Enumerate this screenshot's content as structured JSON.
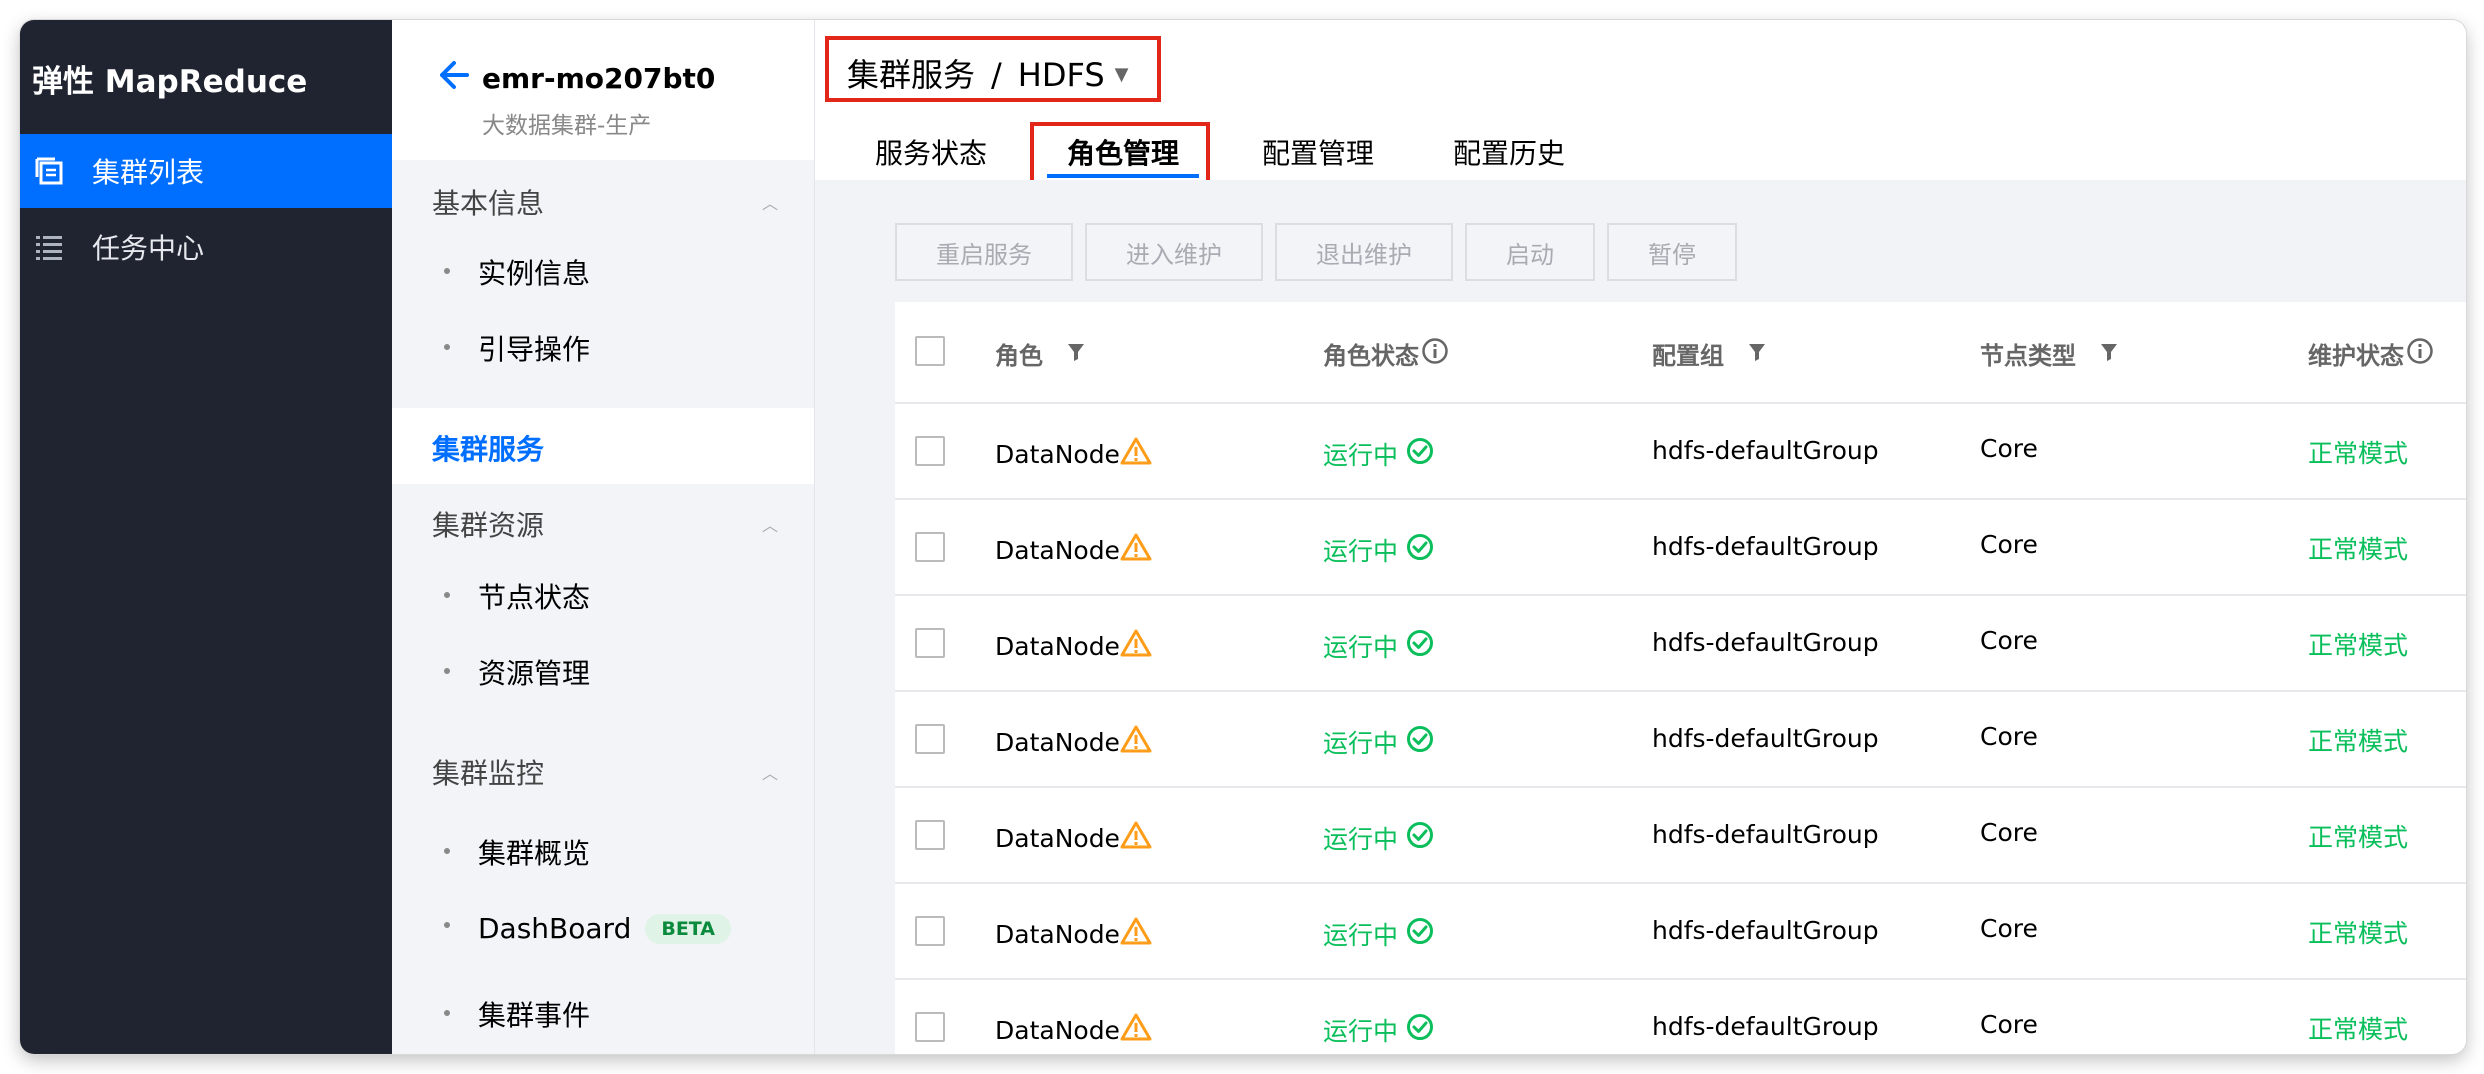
{
  "app": {
    "brand": "弹性 MapReduce"
  },
  "nav": [
    {
      "label": "集群列表",
      "active": true,
      "icon": "cluster-list-icon"
    },
    {
      "label": "任务中心",
      "active": false,
      "icon": "task-list-icon"
    }
  ],
  "cluster": {
    "id": "emr-mo207bt0",
    "subtitle": "大数据集群-生产"
  },
  "menu": {
    "basic": {
      "title": "基本信息",
      "items": [
        "实例信息",
        "引导操作"
      ]
    },
    "service": {
      "title": "集群服务"
    },
    "resource": {
      "title": "集群资源",
      "items": [
        "节点状态",
        "资源管理"
      ]
    },
    "monitor": {
      "title": "集群监控",
      "items": [
        "集群概览",
        "DashBoard",
        "集群事件"
      ],
      "beta_badge": "BETA"
    }
  },
  "breadcrumb": {
    "parent": "集群服务",
    "separator": "/",
    "current": "HDFS"
  },
  "tabs": [
    "服务状态",
    "角色管理",
    "配置管理",
    "配置历史"
  ],
  "active_tab": "角色管理",
  "toolbar": [
    "重启服务",
    "进入维护",
    "退出维护",
    "启动",
    "暂停"
  ],
  "table": {
    "columns": [
      "角色",
      "角色状态",
      "配置组",
      "节点类型",
      "维护状态"
    ],
    "rows": [
      {
        "role": "DataNode",
        "status": "运行中",
        "group": "hdfs-defaultGroup",
        "node_type": "Core",
        "maintenance": "正常模式"
      },
      {
        "role": "DataNode",
        "status": "运行中",
        "group": "hdfs-defaultGroup",
        "node_type": "Core",
        "maintenance": "正常模式"
      },
      {
        "role": "DataNode",
        "status": "运行中",
        "group": "hdfs-defaultGroup",
        "node_type": "Core",
        "maintenance": "正常模式"
      },
      {
        "role": "DataNode",
        "status": "运行中",
        "group": "hdfs-defaultGroup",
        "node_type": "Core",
        "maintenance": "正常模式"
      },
      {
        "role": "DataNode",
        "status": "运行中",
        "group": "hdfs-defaultGroup",
        "node_type": "Core",
        "maintenance": "正常模式"
      },
      {
        "role": "DataNode",
        "status": "运行中",
        "group": "hdfs-defaultGroup",
        "node_type": "Core",
        "maintenance": "正常模式"
      },
      {
        "role": "DataNode",
        "status": "运行中",
        "group": "hdfs-defaultGroup",
        "node_type": "Core",
        "maintenance": "正常模式"
      }
    ]
  },
  "colors": {
    "accent": "#006eff",
    "success": "#0abf5b",
    "warning": "#ff9c19",
    "highlight": "#e3261a",
    "nav_bg": "#1f2430"
  }
}
